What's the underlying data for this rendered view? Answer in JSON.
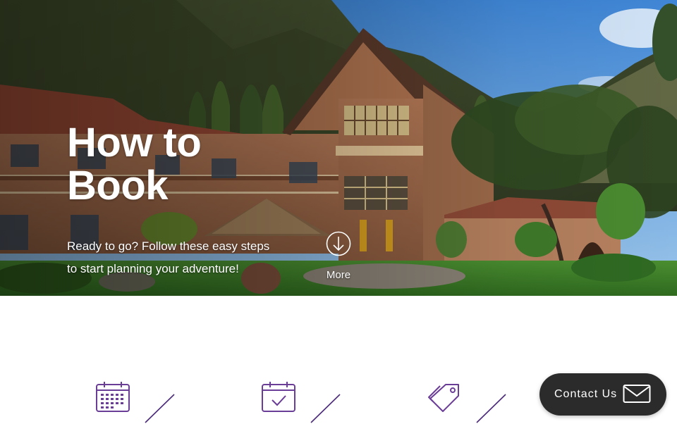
{
  "hero": {
    "title": "How to Book",
    "subtitle": "Ready to go? Follow these easy steps to start planning your adventure!",
    "more_label": "More"
  },
  "steps": {
    "icons": [
      "calendar-grid-icon",
      "calendar-check-icon",
      "price-tag-icon"
    ]
  },
  "contact": {
    "label": "Contact Us",
    "icon": "mail-icon"
  },
  "colors": {
    "step_icon": "#6a3d96",
    "divider_line": "#4b2a7a",
    "contact_bg": "#2b2b2b",
    "sky": "#4a8fd6",
    "lawn": "#3f7f2a",
    "building_wall": "#a86e4e",
    "roof_tiles": "#9a4a35"
  }
}
